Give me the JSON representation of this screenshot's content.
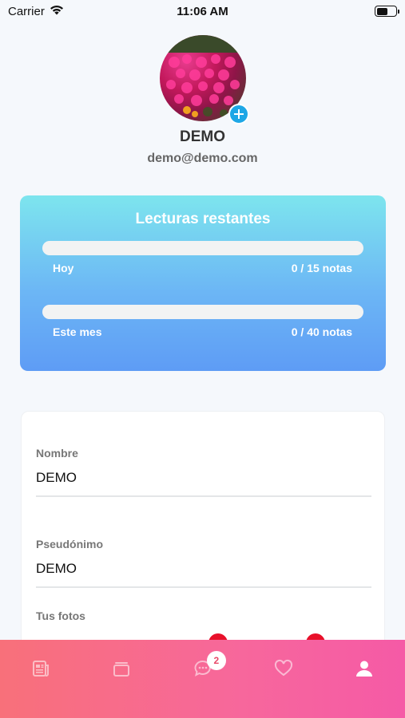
{
  "status_bar": {
    "carrier": "Carrier",
    "time": "11:06 AM"
  },
  "profile": {
    "name": "DEMO",
    "email": "demo@demo.com"
  },
  "reads": {
    "title": "Lecturas restantes",
    "today": {
      "label": "Hoy",
      "count": "0 / 15 notas",
      "progress": 0
    },
    "month": {
      "label": "Este mes",
      "count": "0 / 40 notas",
      "progress": 0
    }
  },
  "form": {
    "name_label": "Nombre",
    "name_value": "DEMO",
    "alias_label": "Pseudónimo",
    "alias_value": "DEMO",
    "photos_label": "Tus fotos"
  },
  "tabbar": {
    "items": [
      {
        "icon": "newspaper-icon"
      },
      {
        "icon": "cards-icon"
      },
      {
        "icon": "chat-icon",
        "badge": "2"
      },
      {
        "icon": "heart-icon"
      },
      {
        "icon": "user-icon",
        "active": true
      }
    ]
  },
  "colors": {
    "card_gradient_top": "#7de5ee",
    "card_gradient_bottom": "#5e9cf5",
    "tabbar_left": "#f8707a",
    "tabbar_right": "#f55aa6",
    "accent_add": "#1ea7e6",
    "badge_red": "#e8102a"
  }
}
